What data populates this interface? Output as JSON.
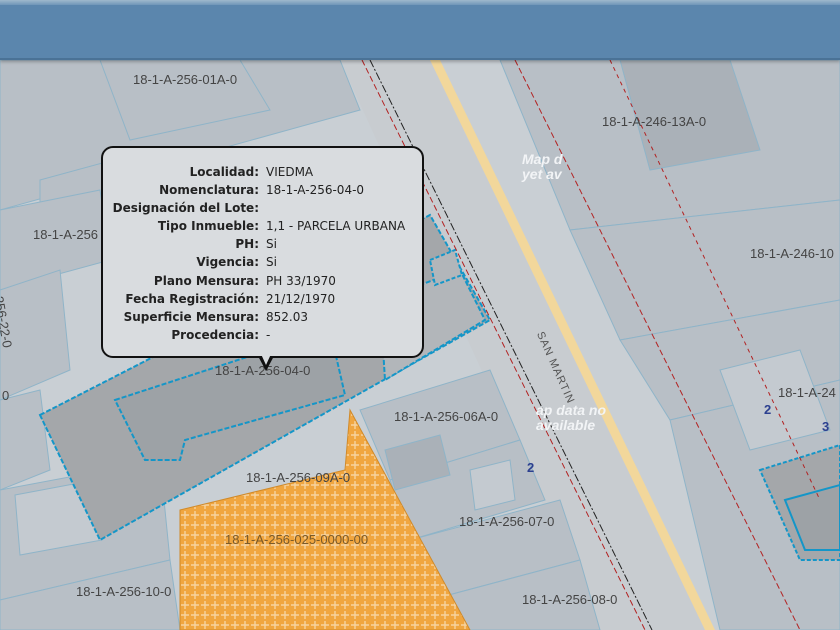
{
  "map": {
    "parcel_labels": [
      "18-1-A-256-01A-0",
      "18-1-A-246-13A-0",
      "18-1-A-256",
      "18-1-A-246-10",
      "256-22-0",
      "0",
      "18-1-A-256-04-0",
      "18-1-A-256-06A-0",
      "18-1-A-24",
      "18-1-A-256-09A-0",
      "18-1-A-256-025-0000-00",
      "18-1-A-256-07-0",
      "18-1-A-256-10-0",
      "18-1-A-256-08-0"
    ],
    "unit_numbers": [
      "2",
      "2",
      "3"
    ],
    "street_name": "SAN MARTIN",
    "no_data_messages": [
      "Map d\nyet av",
      "ap data no\navailable"
    ],
    "colors": {
      "parcel_fill": "#b8bfc6",
      "selected_parcel_fill": "#a4a7aa",
      "selected_outline": "#1496c8",
      "parcel_outline": "#8fb4c8",
      "street_centerline": "#f2d79b",
      "hatch_fill": "#f0a640",
      "boundary_dash": "#b22222",
      "header_bg": "#5b86ad"
    }
  },
  "popup": {
    "rows": [
      {
        "label": "Localidad:",
        "value": "VIEDMA"
      },
      {
        "label": "Nomenclatura:",
        "value": "18-1-A-256-04-0"
      },
      {
        "label": "Designación del Lote:",
        "value": ""
      },
      {
        "label": "Tipo Inmueble:",
        "value": "1,1 - PARCELA URBANA"
      },
      {
        "label": "PH:",
        "value": "Si"
      },
      {
        "label": "Vigencia:",
        "value": "Si"
      },
      {
        "label": "Plano Mensura:",
        "value": "PH 33/1970"
      },
      {
        "label": "Fecha Registración:",
        "value": "21/12/1970"
      },
      {
        "label": "Superficie Mensura:",
        "value": "852.03"
      },
      {
        "label": "Procedencia:",
        "value": "-"
      }
    ]
  }
}
